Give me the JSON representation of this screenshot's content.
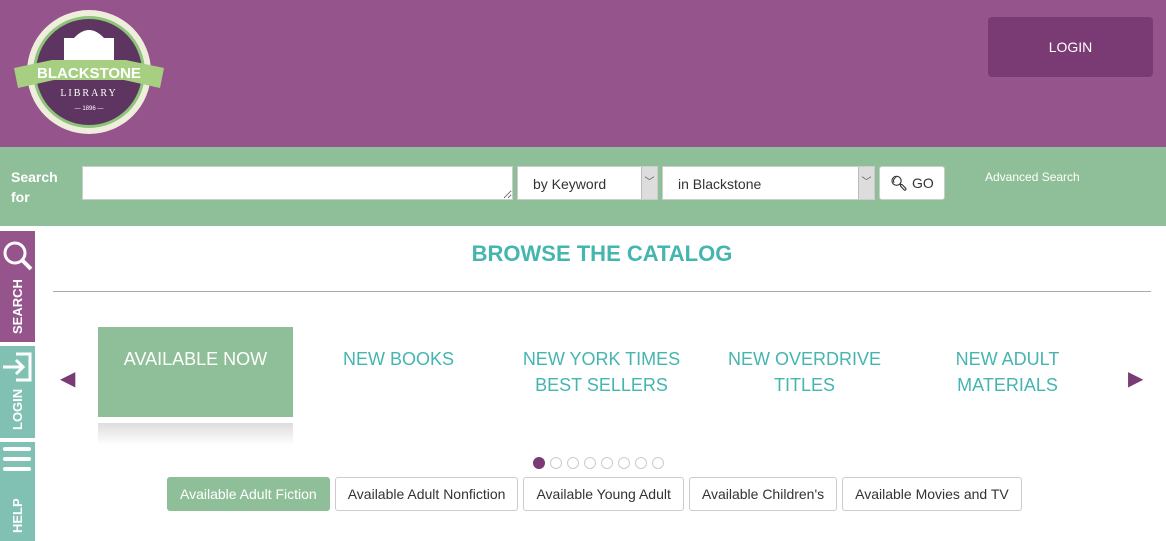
{
  "header": {
    "logo_text": "BLACKSTONE LIBRARY 1896",
    "login_label": "LOGIN"
  },
  "search": {
    "label": "Search for",
    "value": "",
    "type_selected": "by Keyword",
    "scope_selected": "in Blackstone",
    "go_label": "GO",
    "advanced_label": "Advanced Search"
  },
  "side_tabs": [
    {
      "label": "SEARCH",
      "icon": "search-icon",
      "color": "#95548c"
    },
    {
      "label": "LOGIN",
      "icon": "login-icon",
      "color": "#80c1b4"
    },
    {
      "label": "HELP",
      "icon": "menu-icon",
      "color": "#80c1b4"
    }
  ],
  "browse": {
    "title": "BROWSE THE CATALOG",
    "slides": [
      "AVAILABLE NOW",
      "NEW BOOKS",
      "NEW YORK TIMES BEST SELLERS",
      "NEW OVERDRIVE TITLES",
      "NEW ADULT MATERIALS"
    ],
    "active_slide": 0,
    "page_count": 8,
    "active_page": 0,
    "tabs": [
      "Available Adult Fiction",
      "Available Adult Nonfiction",
      "Available Young Adult",
      "Available Children's",
      "Available Movies and TV"
    ],
    "active_tab": 0
  },
  "colors": {
    "header": "#95548c",
    "searchbar": "#8fbf98",
    "accent": "#45b5b0",
    "dark_purple": "#7a3a74"
  }
}
